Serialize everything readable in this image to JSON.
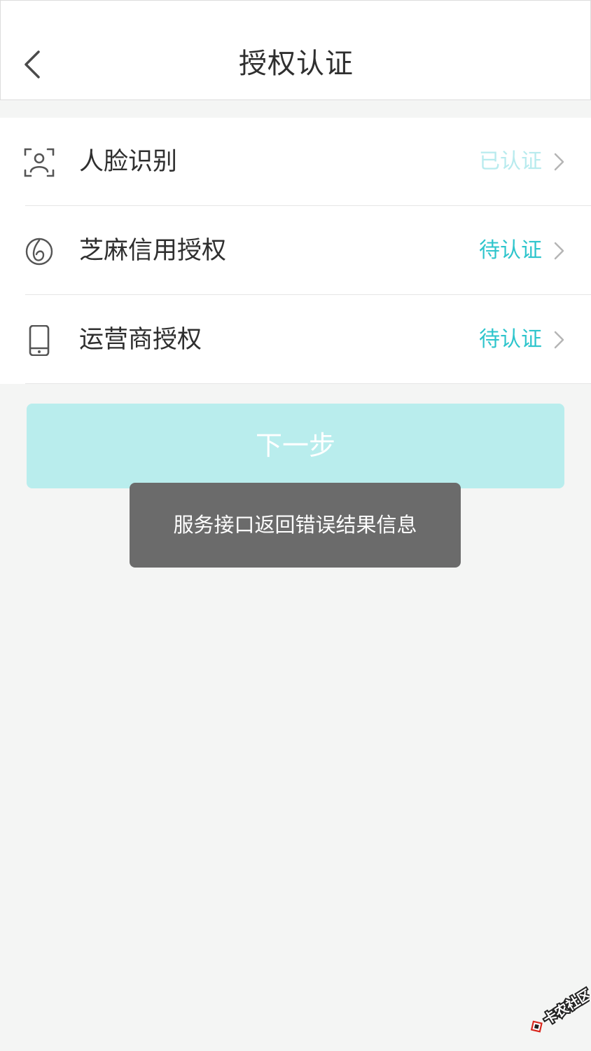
{
  "header": {
    "title": "授权认证"
  },
  "auth_items": [
    {
      "label": "人脸识别",
      "status": "已认证",
      "status_color": "#b8ebee",
      "icon": "face-scan-icon"
    },
    {
      "label": "芝麻信用授权",
      "status": "待认证",
      "status_color": "#2ec5cc",
      "icon": "sesame-credit-icon"
    },
    {
      "label": "运营商授权",
      "status": "待认证",
      "status_color": "#2ec5cc",
      "icon": "phone-icon"
    }
  ],
  "next_button": {
    "label": "下一步",
    "bg_color": "#b9eded"
  },
  "toast": {
    "message": "服务接口返回错误结果信息"
  },
  "watermark": {
    "text": "卡农社区"
  }
}
